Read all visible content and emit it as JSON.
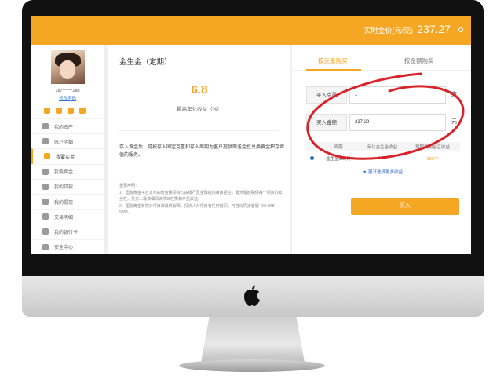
{
  "header": {
    "price_label": "实时金价(元/克)",
    "price_value": "237.27"
  },
  "sidebar": {
    "user_id": "187******288",
    "edit_password": "修改密码",
    "items": [
      {
        "label": "我的资产",
        "icon": "pie-icon"
      },
      {
        "label": "账户明细",
        "icon": "list-icon"
      },
      {
        "label": "我要买金",
        "icon": "gold-icon",
        "active": true
      },
      {
        "label": "我要卖金",
        "icon": "cart-icon"
      },
      {
        "label": "我的贷款",
        "icon": "loan-icon"
      },
      {
        "label": "我的提现",
        "icon": "wallet-icon"
      },
      {
        "label": "交易明细",
        "icon": "detail-icon"
      },
      {
        "label": "我的银行卡",
        "icon": "card-icon"
      },
      {
        "label": "安全中心",
        "icon": "shield-icon"
      }
    ]
  },
  "product": {
    "title": "金生金（定期）",
    "rate": "6.8",
    "rate_label": "最高年化收益（%）",
    "description": "存入黄金后，可按存入固定克重和存入周期为客户提供赠送金豆兑换黄金积存增值的服务。",
    "notice_title": "重要声明：",
    "notice_1": "1、国融黄金平台发布的黄金保项目均由银行及金融机构审核把控，最大程度确保每个项目的安全性。投资人需详细阅读项目性质和产品收益。",
    "notice_2": "2、国融黄金有权对项目做最终解释。投资人对项目有任何疑问，可咨询同步客服 400-868-9955。"
  },
  "buy_panel": {
    "tab_weight": "按克重购买",
    "tab_amount": "按金额购买",
    "weight_label": "买入克重",
    "weight_value": "1",
    "weight_unit": "克",
    "amount_label": "买入金额",
    "amount_value": "237.29",
    "amount_unit": "元",
    "table_headers": [
      "周期",
      "年化金生金收益",
      "预期到期金豆收益"
    ],
    "table_row": {
      "period": "金生金360天",
      "rate": "6.8%",
      "beans": "680个"
    },
    "more_link": "▼ 展开选择更多收益",
    "buy_button": "买入"
  },
  "colors": {
    "accent": "#f5a623",
    "annotation": "#d9232a",
    "link": "#2f6cc8"
  }
}
